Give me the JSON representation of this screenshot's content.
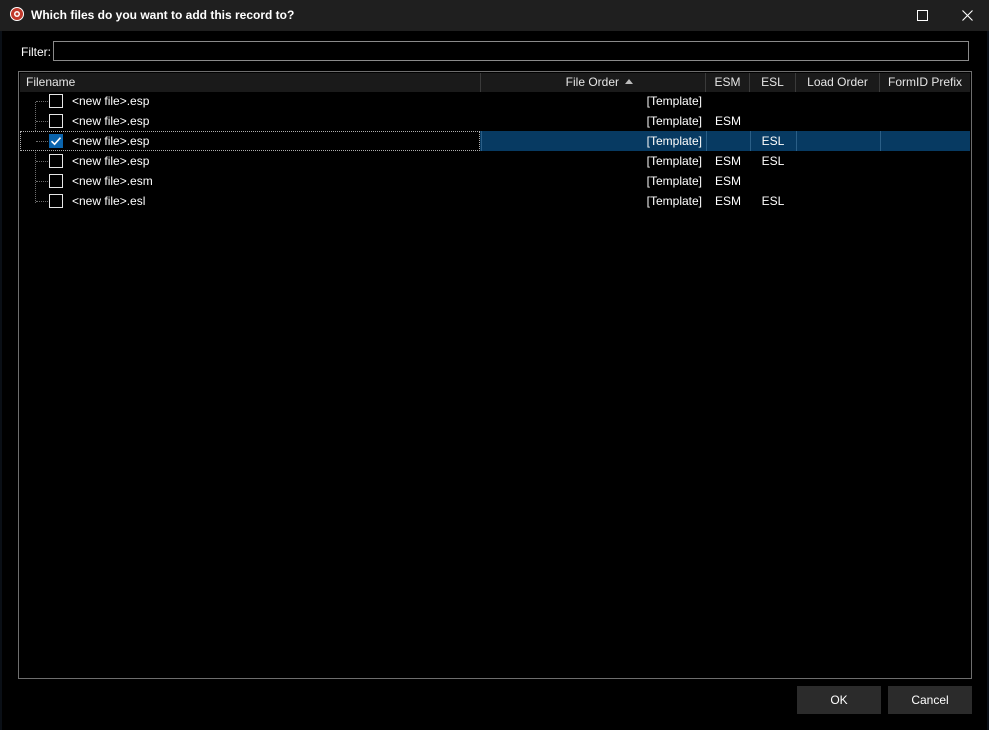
{
  "window": {
    "title": "Which files do you want to add this record to?",
    "icons": {
      "app": "app-icon",
      "maximize": "maximize-icon",
      "close": "close-icon"
    }
  },
  "filter": {
    "label": "Filter:",
    "value": ""
  },
  "tree": {
    "columns": {
      "filename": "Filename",
      "file_order": "File Order",
      "esm": "ESM",
      "esl": "ESL",
      "load_order": "Load Order",
      "formid_prefix": "FormID Prefix"
    },
    "sort": {
      "column": "File Order",
      "direction": "ascending"
    },
    "rows": [
      {
        "filename": "<new file>.esp",
        "file_order": "[Template]",
        "esm": "",
        "esl": "",
        "load_order": "",
        "formid_prefix": "",
        "checked": false,
        "selected": false
      },
      {
        "filename": "<new file>.esp",
        "file_order": "[Template]",
        "esm": "ESM",
        "esl": "",
        "load_order": "",
        "formid_prefix": "",
        "checked": false,
        "selected": false
      },
      {
        "filename": "<new file>.esp",
        "file_order": "[Template]",
        "esm": "",
        "esl": "ESL",
        "load_order": "",
        "formid_prefix": "",
        "checked": true,
        "selected": true
      },
      {
        "filename": "<new file>.esp",
        "file_order": "[Template]",
        "esm": "ESM",
        "esl": "ESL",
        "load_order": "",
        "formid_prefix": "",
        "checked": false,
        "selected": false
      },
      {
        "filename": "<new file>.esm",
        "file_order": "[Template]",
        "esm": "ESM",
        "esl": "",
        "load_order": "",
        "formid_prefix": "",
        "checked": false,
        "selected": false
      },
      {
        "filename": "<new file>.esl",
        "file_order": "[Template]",
        "esm": "ESM",
        "esl": "ESL",
        "load_order": "",
        "formid_prefix": "",
        "checked": false,
        "selected": false
      }
    ]
  },
  "buttons": {
    "ok": "OK",
    "cancel": "Cancel"
  },
  "colors": {
    "selection": "#073a62",
    "checkbox_checked": "#0a64ad",
    "background": "#000000"
  }
}
